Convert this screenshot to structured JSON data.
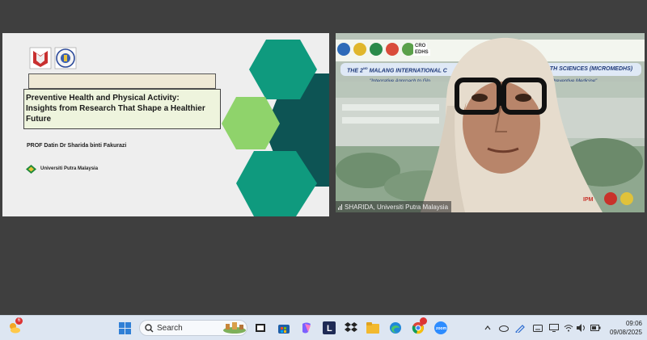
{
  "slide": {
    "title_lines": [
      "Preventive Health and Physical Activity:",
      "Insights from Research That Shape a Healthier",
      "Future"
    ],
    "author": "PROF Datin Dr Sharida binti Fakurazi",
    "university": "Universiti Putra Malaysia",
    "colors": {
      "hex_teal": "#0f9a7e",
      "hex_dark": "#0d5454",
      "hex_lime": "#8fd36b"
    }
  },
  "video": {
    "participant_name": "SHARIDA, Universiti Putra Malaysia",
    "banner": {
      "logo_labels": [
        "CRO",
        "EDHS"
      ],
      "headline_left": "THE 2",
      "headline_mid": " MALANG INTERNATIONAL C",
      "headline_right": "ALTH SCIENCES (MICROMEDHS)",
      "subtitle_left": "\"Integrative Approach to Glo",
      "subtitle_right": "d Preventive Medicine\""
    }
  },
  "taskbar": {
    "search_placeholder": "Search",
    "weather_badge": "6",
    "clock_time": "09:06",
    "clock_date": "09/08/2025",
    "icons": [
      "weather-icon",
      "start-icon",
      "search-icon",
      "widgets-icon",
      "task-view-icon",
      "store-icon",
      "copilot-icon",
      "app-l-icon",
      "dropbox-icon",
      "file-explorer-icon",
      "edge-icon",
      "chrome-icon",
      "zoom-icon"
    ],
    "tray_icons": [
      "chevron-up-icon",
      "onedrive-icon",
      "pen-icon",
      "keyboard-icon",
      "display-icon",
      "wifi-icon",
      "volume-icon",
      "battery-icon"
    ]
  }
}
